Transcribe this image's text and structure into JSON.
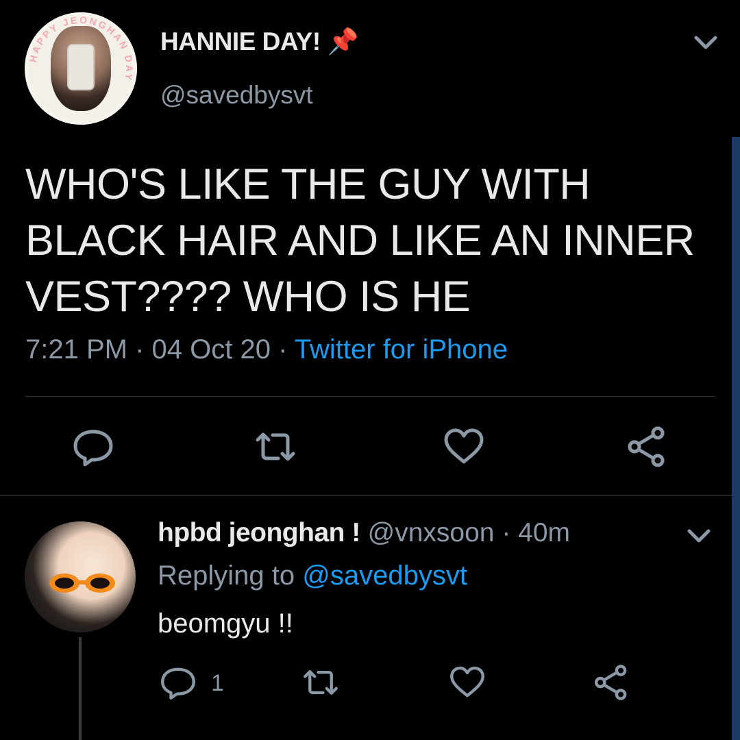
{
  "tweet": {
    "author_name": "HANNIE DAY! 📌",
    "author_handle": "@savedbysvt",
    "avatar_ring_text": "HAPPY JEONGHAN DAY",
    "text": "WHO'S LIKE THE GUY WITH BLACK HAIR AND LIKE AN INNER VEST???? WHO IS HE",
    "time": "7:21 PM",
    "date": "04 Oct 20",
    "source": "Twitter for iPhone",
    "separator": " · "
  },
  "actions": {
    "reply_icon": "speech-bubble-icon",
    "retweet_icon": "retweet-icon",
    "like_icon": "heart-icon",
    "share_icon": "share-icon"
  },
  "reply": {
    "author_name": "hpbd jeonghan !",
    "author_handle": "@vnxsoon",
    "age": "40m",
    "replying_label": "Replying to",
    "replying_to": "@savedbysvt",
    "text": "beomgyu !!",
    "reply_count": "1"
  },
  "colors": {
    "background": "#000000",
    "text": "#e7e9ea",
    "secondary": "#8b98a5",
    "accent": "#1d9bf0"
  }
}
